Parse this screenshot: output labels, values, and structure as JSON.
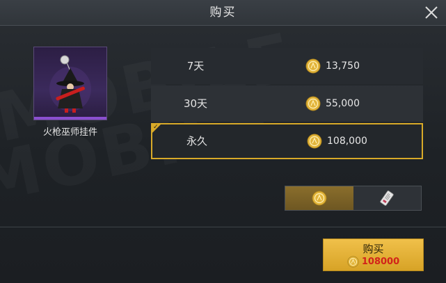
{
  "dialog": {
    "title": "购买",
    "close_icon": "close-icon"
  },
  "item": {
    "name": "火枪巫师挂件",
    "rarity_color": "#8b4fd0",
    "image_icon": "witch-pendant-icon"
  },
  "options": [
    {
      "duration": "7天",
      "price": "13,750",
      "selected": false
    },
    {
      "duration": "30天",
      "price": "55,000",
      "selected": false
    },
    {
      "duration": "永久",
      "price": "108,000",
      "selected": true
    }
  ],
  "currency_toggle": {
    "items": [
      {
        "icon": "coin-icon",
        "active": true
      },
      {
        "icon": "coupon-ticket-icon",
        "active": false
      }
    ]
  },
  "buy_button": {
    "label": "购买",
    "price": "108000",
    "price_color": "#d2231a"
  },
  "colors": {
    "accent_gold": "#d9aa28",
    "rarity_purple": "#8b4fd0"
  }
}
